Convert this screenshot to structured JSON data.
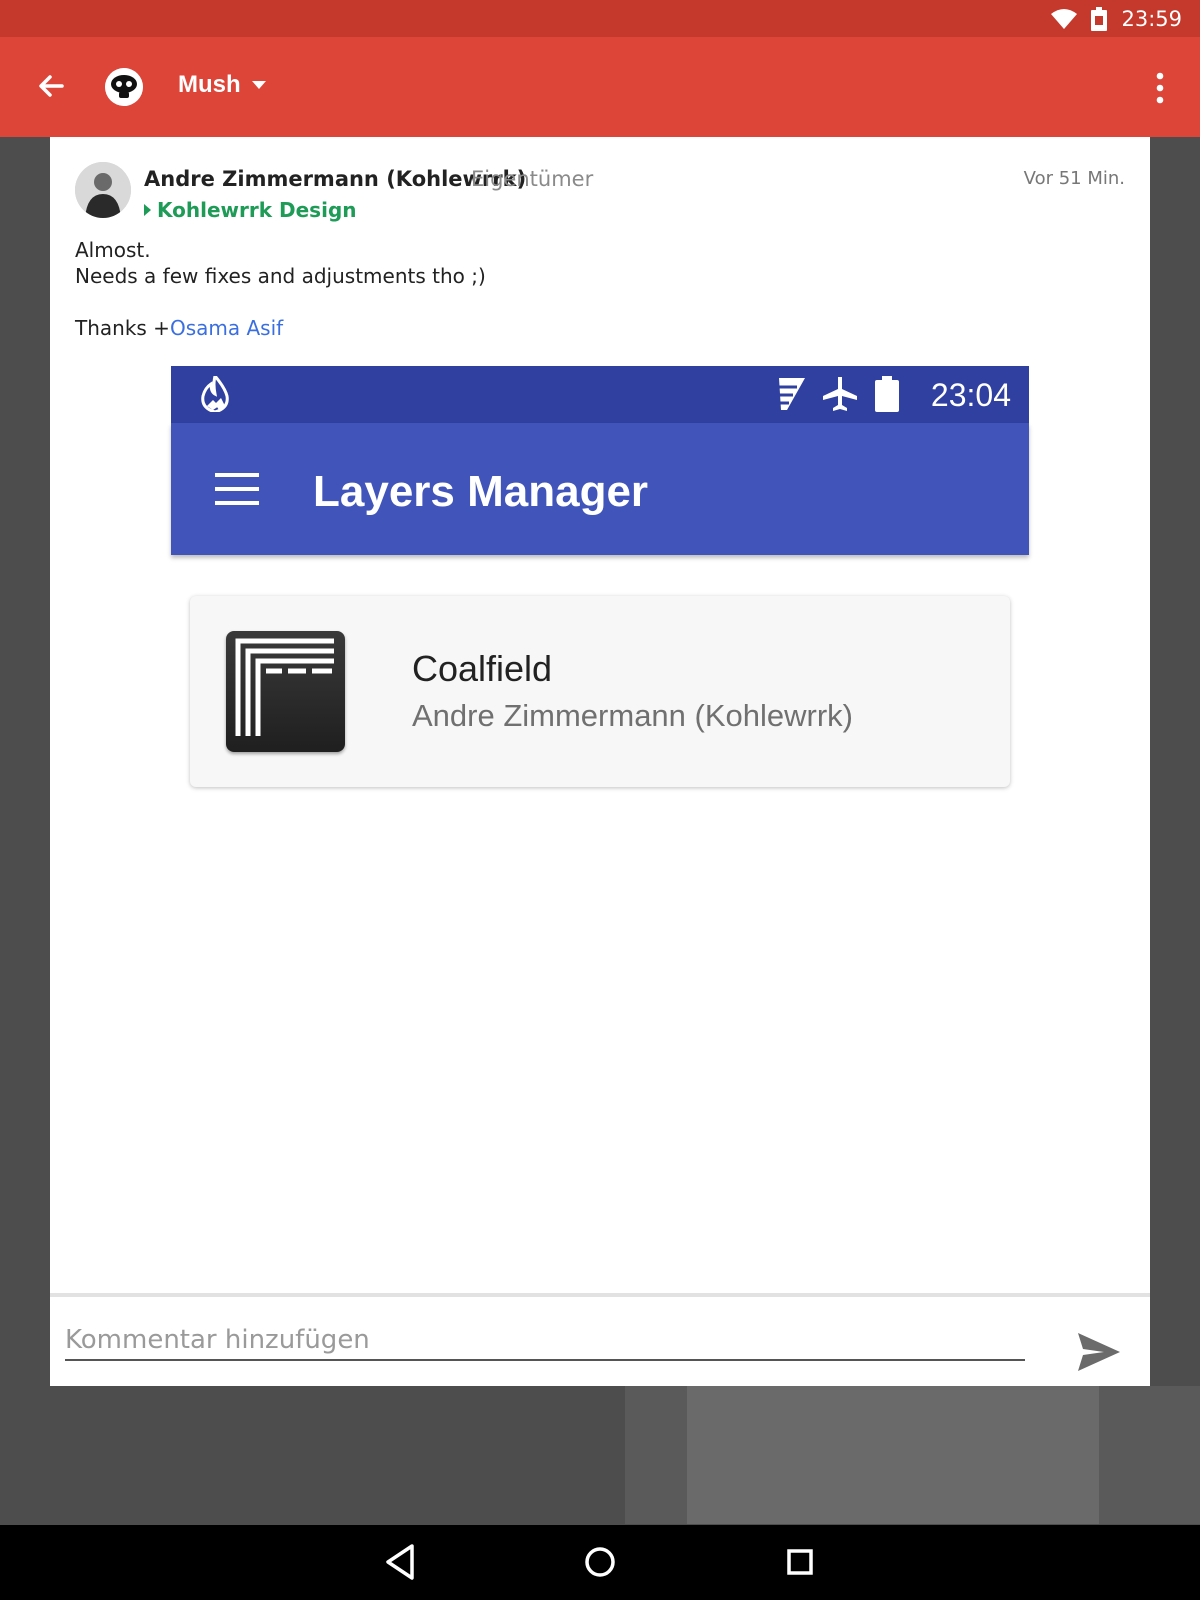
{
  "status_bar": {
    "time": "23:59",
    "icons": [
      "wifi-icon",
      "battery-icon"
    ]
  },
  "app_bar": {
    "title": "Mush",
    "icons": [
      "back-arrow-icon",
      "community-avatar",
      "dropdown-icon",
      "overflow-menu-icon"
    ]
  },
  "post": {
    "author": "Andre Zimmermann (Kohlewrrk)",
    "role": "Eigentümer",
    "time_ago": "Vor 51 Min.",
    "community": "Kohlewrrk Design",
    "body_line1": "Almost.",
    "body_line2": "Needs a few fixes and adjustments tho ;)",
    "thanks_prefix": "Thanks +",
    "mention": "Osama Asif"
  },
  "embedded_screenshot": {
    "status_time": "23:04",
    "status_icons": [
      "flame-icon",
      "signal-icon",
      "airplane-icon",
      "battery-icon"
    ],
    "toolbar_title": "Layers Manager",
    "layer": {
      "name": "Coalfield",
      "author": "Andre Zimmermann (Kohlewrrk)"
    }
  },
  "comment": {
    "placeholder": "Kommentar hinzufügen"
  },
  "nav_bar": {
    "icons": [
      "back-triangle-icon",
      "home-circle-icon",
      "recents-square-icon"
    ]
  },
  "colors": {
    "status_bar": "#c5392c",
    "app_bar": "#dd4539",
    "community_green": "#1e9b57",
    "mention_blue": "#3b6fe0",
    "embedded_status": "#3040a0",
    "embedded_toolbar": "#4154b9"
  }
}
